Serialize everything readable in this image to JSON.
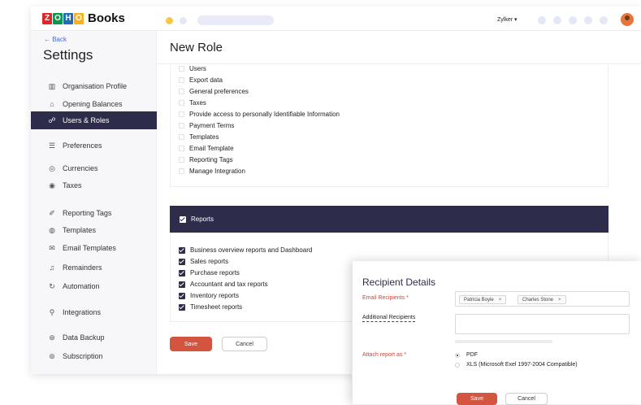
{
  "topbar": {
    "logo_letters": [
      "Z",
      "O",
      "H",
      "O"
    ],
    "logo_colors": [
      "#e42527",
      "#089949",
      "#226db4",
      "#f9b21d"
    ],
    "app_name": "Books",
    "org_menu": "Zylker ▾",
    "avatar_color": "#e8753a"
  },
  "sidebar": {
    "back_label": "← Back",
    "title": "Settings",
    "items": [
      {
        "label": "Organisation Profile",
        "icon": "building-icon",
        "glyph": "▥"
      },
      {
        "label": "Opening Balances",
        "icon": "bank-icon",
        "glyph": "⌂"
      },
      {
        "label": "Users & Roles",
        "icon": "users-icon",
        "glyph": "☍"
      },
      {
        "label": "Preferences",
        "icon": "sliders-icon",
        "glyph": "☰"
      },
      {
        "label": "Currencies",
        "icon": "currency-icon",
        "glyph": "◎"
      },
      {
        "label": "Taxes",
        "icon": "tax-icon",
        "glyph": "◉"
      },
      {
        "label": "Reporting Tags",
        "icon": "tag-icon",
        "glyph": "✐"
      },
      {
        "label": "Templates",
        "icon": "template-icon",
        "glyph": "◍"
      },
      {
        "label": "Email Templates",
        "icon": "mail-icon",
        "glyph": "✉"
      },
      {
        "label": "Remainders",
        "icon": "bell-icon",
        "glyph": "♫"
      },
      {
        "label": "Automation",
        "icon": "automation-icon",
        "glyph": "↻"
      },
      {
        "label": "Integrations",
        "icon": "plug-icon",
        "glyph": "⚲"
      },
      {
        "label": "Data Backup",
        "icon": "backup-icon",
        "glyph": "⊛"
      },
      {
        "label": "Subscription",
        "icon": "subscription-icon",
        "glyph": "⊚"
      }
    ],
    "active_index": 2
  },
  "main": {
    "title": "New Role",
    "settings_permissions": [
      "Users",
      "Export data",
      "General preferences",
      "Taxes",
      "Provide access to personally Identifiable Information",
      "Payment Terms",
      "Templates",
      "Email Template",
      "Reporting Tags",
      "Manage Integration"
    ],
    "reports": {
      "header": "Reports",
      "items": [
        "Business overview reports and Dashboard",
        "Sales reports",
        "Purchase reports",
        "Accountant and tax reports",
        "Inventory reports",
        "Timesheet reports"
      ]
    },
    "save_label": "Save",
    "cancel_label": "Cancel"
  },
  "dialog": {
    "title": "Recipient Details",
    "email_label": "Email Recipients *",
    "recipients": [
      "Patricia Boyle",
      "Charles Stone"
    ],
    "chip_close": "×",
    "additional_label": "Additional Recipients",
    "attach_label": "Attach report as *",
    "formats": [
      {
        "label": "PDF",
        "selected": true
      },
      {
        "label": "XLS (Microsoft Exel 1997-2004 Compatible)",
        "selected": false
      }
    ],
    "save_label": "Save",
    "cancel_label": "Cancel"
  },
  "colors": {
    "accent_dark": "#2d2c4b",
    "save_button": "#d4553f",
    "link": "#3d6ae0",
    "required_label": "#d0463a"
  }
}
